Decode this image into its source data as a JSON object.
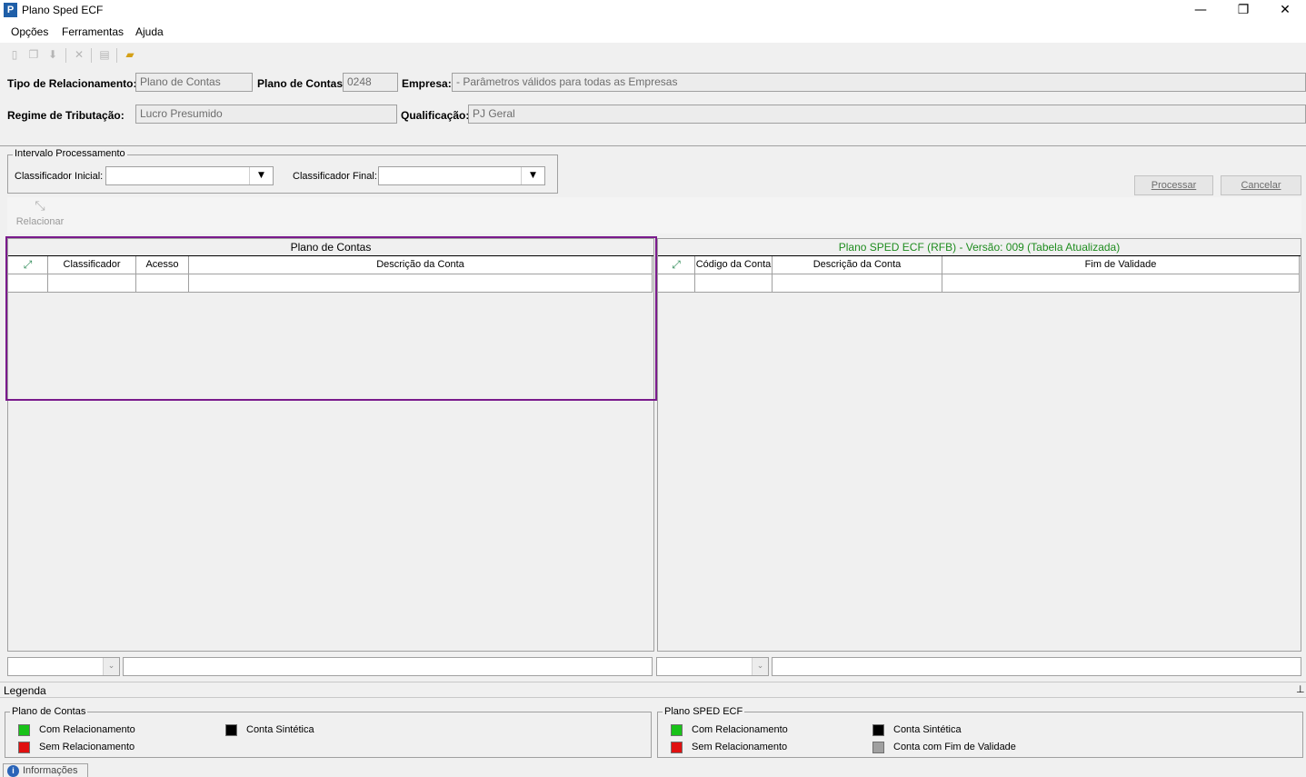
{
  "window": {
    "title": "Plano Sped ECF",
    "minimize_glyph": "—",
    "restore_glyph": "❐",
    "close_glyph": "✕"
  },
  "menu": [
    "Opções",
    "Ferramentas",
    "Ajuda"
  ],
  "toolbar_icons": [
    "new-doc-icon",
    "copy-icon",
    "download-icon",
    "delete-icon",
    "print-icon",
    "open-folder-icon"
  ],
  "header": {
    "tipo_label": "Tipo de Relacionamento:",
    "tipo_value": "Plano de Contas",
    "plano_label": "Plano de Contas:",
    "plano_value": "0248",
    "empresa_label": "Empresa:",
    "empresa_value": " - Parâmetros válidos para todas as Empresas",
    "regime_label": "Regime de Tributação:",
    "regime_value": "Lucro Presumido",
    "qualificacao_label": "Qualificação:",
    "qualificacao_value": "PJ Geral"
  },
  "intervalo": {
    "title": "Intervalo Processamento",
    "inicial_label": "Classificador Inicial:",
    "inicial_value": "",
    "final_label": "Classificador Final:",
    "final_value": ""
  },
  "buttons": {
    "processar": "Processar",
    "cancelar": "Cancelar",
    "relacionar": "Relacionar"
  },
  "left_grid": {
    "title": "Plano de Contas",
    "columns": [
      "Classificador",
      "Acesso",
      "Descrição da Conta"
    ]
  },
  "right_grid": {
    "title": "Plano SPED ECF (RFB) - Versão: 009 (Tabela Atualizada)",
    "title_color": "#1e8c1e",
    "columns": [
      "Código da Conta",
      "Descrição da Conta",
      "Fim de Validade"
    ]
  },
  "legend": {
    "bar_title": "Legenda",
    "left": {
      "title": "Plano de Contas",
      "items": [
        {
          "label": "Com Relacionamento",
          "color": "#19c219"
        },
        {
          "label": "Sem Relacionamento",
          "color": "#e01010"
        },
        {
          "label": "Conta Sintética",
          "color": "#000000"
        }
      ]
    },
    "right": {
      "title": "Plano SPED ECF",
      "items": [
        {
          "label": "Com Relacionamento",
          "color": "#19c219"
        },
        {
          "label": "Sem Relacionamento",
          "color": "#e01010"
        },
        {
          "label": "Conta Sintética",
          "color": "#000000"
        },
        {
          "label": "Conta com Fim de Validade",
          "color": "#a0a0a0"
        }
      ]
    }
  },
  "status": {
    "info_tab": "Informações"
  },
  "highlight_color": "#7a1a8c"
}
